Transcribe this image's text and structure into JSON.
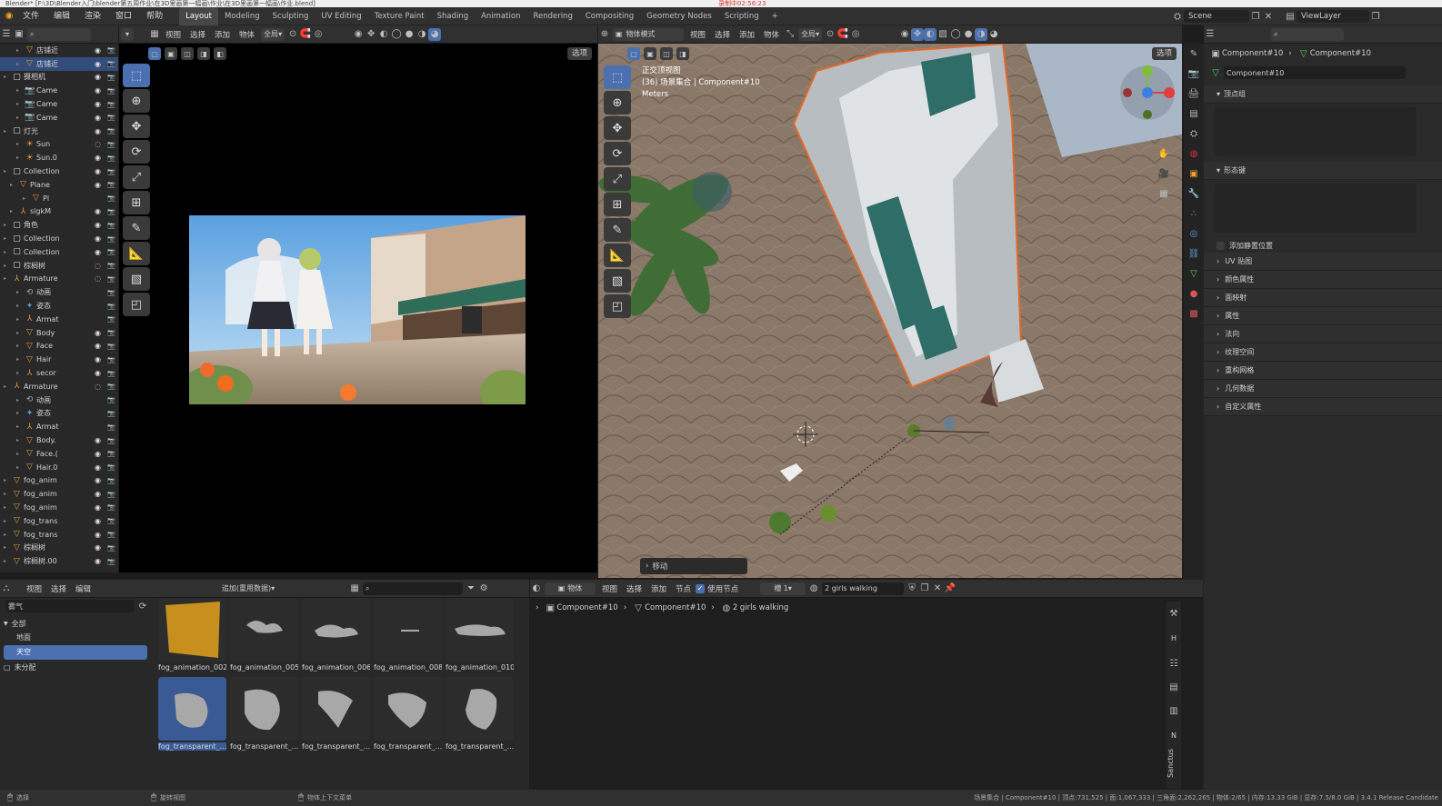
{
  "title_bar": "Blender* [F:\\3D\\Blender入门\\blender第五周作业\\在3D里画第一幅画\\作业\\在3D里画第一幅画\\作业.blend]",
  "recording_label": "录制中02:56:23",
  "menubar": {
    "menus": [
      "文件",
      "编辑",
      "渲染",
      "窗口",
      "帮助"
    ],
    "workspaces": [
      "Layout",
      "Modeling",
      "Sculpting",
      "UV Editing",
      "Texture Paint",
      "Shading",
      "Animation",
      "Rendering",
      "Compositing",
      "Geometry Nodes",
      "Scripting"
    ],
    "active_workspace": "Layout",
    "add_tab": "+",
    "scene_label": "Scene",
    "viewlayer_label": "ViewLayer"
  },
  "render_view_header": {
    "menus": [
      "视图",
      "选择",
      "添加",
      "物体"
    ],
    "global": "全局",
    "options": "选项"
  },
  "viewport_header": {
    "mode": "物体模式",
    "menus": [
      "视图",
      "选择",
      "添加",
      "物体"
    ],
    "global": "全局",
    "options": "选项"
  },
  "viewport": {
    "view_name": "正交顶视图",
    "collection_line": "(36) 场景集合 | Component#10",
    "units": "Meters",
    "operator_panel": "移动",
    "axis_colors": {
      "x": "#e23c3c",
      "y": "#7fbe3b",
      "z": "#3d7fe2"
    }
  },
  "outliner": {
    "rows": [
      {
        "name": "店铺近",
        "icon": "mesh",
        "vis": "◉",
        "sel": false
      },
      {
        "name": "店铺近",
        "icon": "mesh",
        "vis": "◉",
        "sel": true
      },
      {
        "name": "摄相机",
        "icon": "collection",
        "vis": "◉",
        "sel": false
      },
      {
        "name": "Came",
        "icon": "camera",
        "vis": "◉",
        "sel": false
      },
      {
        "name": "Came",
        "icon": "camera",
        "vis": "◉",
        "sel": false
      },
      {
        "name": "Came",
        "icon": "camera",
        "vis": "◉",
        "sel": false
      },
      {
        "name": "灯光",
        "icon": "collection",
        "vis": "◉",
        "sel": false
      },
      {
        "name": "Sun",
        "icon": "light",
        "vis": "◌",
        "sel": false
      },
      {
        "name": "Sun.0",
        "icon": "light",
        "vis": "◉",
        "sel": false
      },
      {
        "name": "Collection",
        "icon": "collection",
        "vis": "◉",
        "sel": false
      },
      {
        "name": "Plane",
        "icon": "mesh",
        "vis": "◉",
        "sel": false
      },
      {
        "name": "Pl",
        "icon": "mesh",
        "vis": "",
        "sel": false
      },
      {
        "name": "slgkM",
        "icon": "armature",
        "vis": "◉",
        "sel": false
      },
      {
        "name": "角色",
        "icon": "collection",
        "vis": "◉",
        "sel": false
      },
      {
        "name": "Collection",
        "icon": "collection",
        "vis": "◉",
        "sel": false
      },
      {
        "name": "Collection",
        "icon": "collection",
        "vis": "◉",
        "sel": false
      },
      {
        "name": "棕榈树",
        "icon": "collection",
        "vis": "◌",
        "sel": false
      },
      {
        "name": "Armature",
        "icon": "armature",
        "vis": "◌",
        "sel": false
      },
      {
        "name": "动画",
        "icon": "action",
        "vis": "",
        "sel": false
      },
      {
        "name": "姿态",
        "icon": "pose",
        "vis": "",
        "sel": false
      },
      {
        "name": "Armat",
        "icon": "armature",
        "vis": "",
        "sel": false
      },
      {
        "name": "Body",
        "icon": "mesh",
        "vis": "◉",
        "sel": false
      },
      {
        "name": "Face",
        "icon": "mesh",
        "vis": "◉",
        "sel": false
      },
      {
        "name": "Hair",
        "icon": "mesh",
        "vis": "◉",
        "sel": false
      },
      {
        "name": "secor",
        "icon": "armature",
        "vis": "◉",
        "sel": false
      },
      {
        "name": "Armature",
        "icon": "armature",
        "vis": "◌",
        "sel": false
      },
      {
        "name": "动画",
        "icon": "action",
        "vis": "",
        "sel": false
      },
      {
        "name": "姿态",
        "icon": "pose",
        "vis": "",
        "sel": false
      },
      {
        "name": "Armat",
        "icon": "armature",
        "vis": "",
        "sel": false
      },
      {
        "name": "Body.",
        "icon": "mesh",
        "vis": "◉",
        "sel": false
      },
      {
        "name": "Face.(",
        "icon": "mesh",
        "vis": "◉",
        "sel": false
      },
      {
        "name": "Hair.0",
        "icon": "mesh",
        "vis": "◉",
        "sel": false
      },
      {
        "name": "fog_anim",
        "icon": "mesh",
        "vis": "◉",
        "sel": false
      },
      {
        "name": "fog_anim",
        "icon": "mesh",
        "vis": "◉",
        "sel": false
      },
      {
        "name": "fog_anim",
        "icon": "mesh",
        "vis": "◉",
        "sel": false
      },
      {
        "name": "fog_trans",
        "icon": "mesh",
        "vis": "◉",
        "sel": false
      },
      {
        "name": "fog_trans",
        "icon": "mesh",
        "vis": "◉",
        "sel": false
      },
      {
        "name": "棕榈树",
        "icon": "mesh",
        "vis": "◉",
        "sel": false
      },
      {
        "name": "棕榈树.00",
        "icon": "mesh",
        "vis": "◉",
        "sel": false
      }
    ]
  },
  "properties": {
    "breadcrumb_obj": "Component#10",
    "breadcrumb_data": "Component#10",
    "mesh_name": "Component#10",
    "sections": [
      "顶点组",
      "形态键"
    ],
    "add_rest_position": "添加静置位置",
    "collapsed_sections": [
      "UV 贴图",
      "颜色属性",
      "面映射",
      "属性",
      "法向",
      "纹理空间",
      "重构网格",
      "几何数据",
      "自定义属性"
    ]
  },
  "asset_browser": {
    "menus": [
      "视图",
      "选择",
      "编辑"
    ],
    "import_mode": "追加(重用数据)",
    "library": "雾气",
    "catalog": {
      "all": "全部",
      "items": [
        "地面",
        "天空"
      ],
      "selected": "天空",
      "unassigned": "未分配"
    },
    "assets": [
      "fog_animation_002",
      "fog_animation_005",
      "fog_animation_006",
      "fog_animation_008",
      "fog_animation_010",
      "fog_transparent_...",
      "fog_transparent_...",
      "fog_transparent_...",
      "fog_transparent_...",
      "fog_transparent_..."
    ]
  },
  "node_editor": {
    "type_label": "物体",
    "menus": [
      "视图",
      "选择",
      "添加",
      "节点"
    ],
    "use_nodes": "使用节点",
    "slot": "槽 1",
    "material": "2 girls walking",
    "breadcrumb": [
      "Component#10",
      "Component#10",
      "2 girls walking"
    ],
    "sidebar_tabs": [
      "H",
      "N",
      "Sanctus"
    ]
  },
  "status_bar": {
    "left": "选择",
    "middle": "旋转视图",
    "context": "物体上下文菜单",
    "right": "场景集合 | Component#10 | 顶点:731,525 | 面:1,067,333 | 三角面:2,262,265 | 物体:2/65 | 内存:13.33 GiB | 显存:7.5/8.0 GiB | 3.4.1 Release Candidate"
  }
}
